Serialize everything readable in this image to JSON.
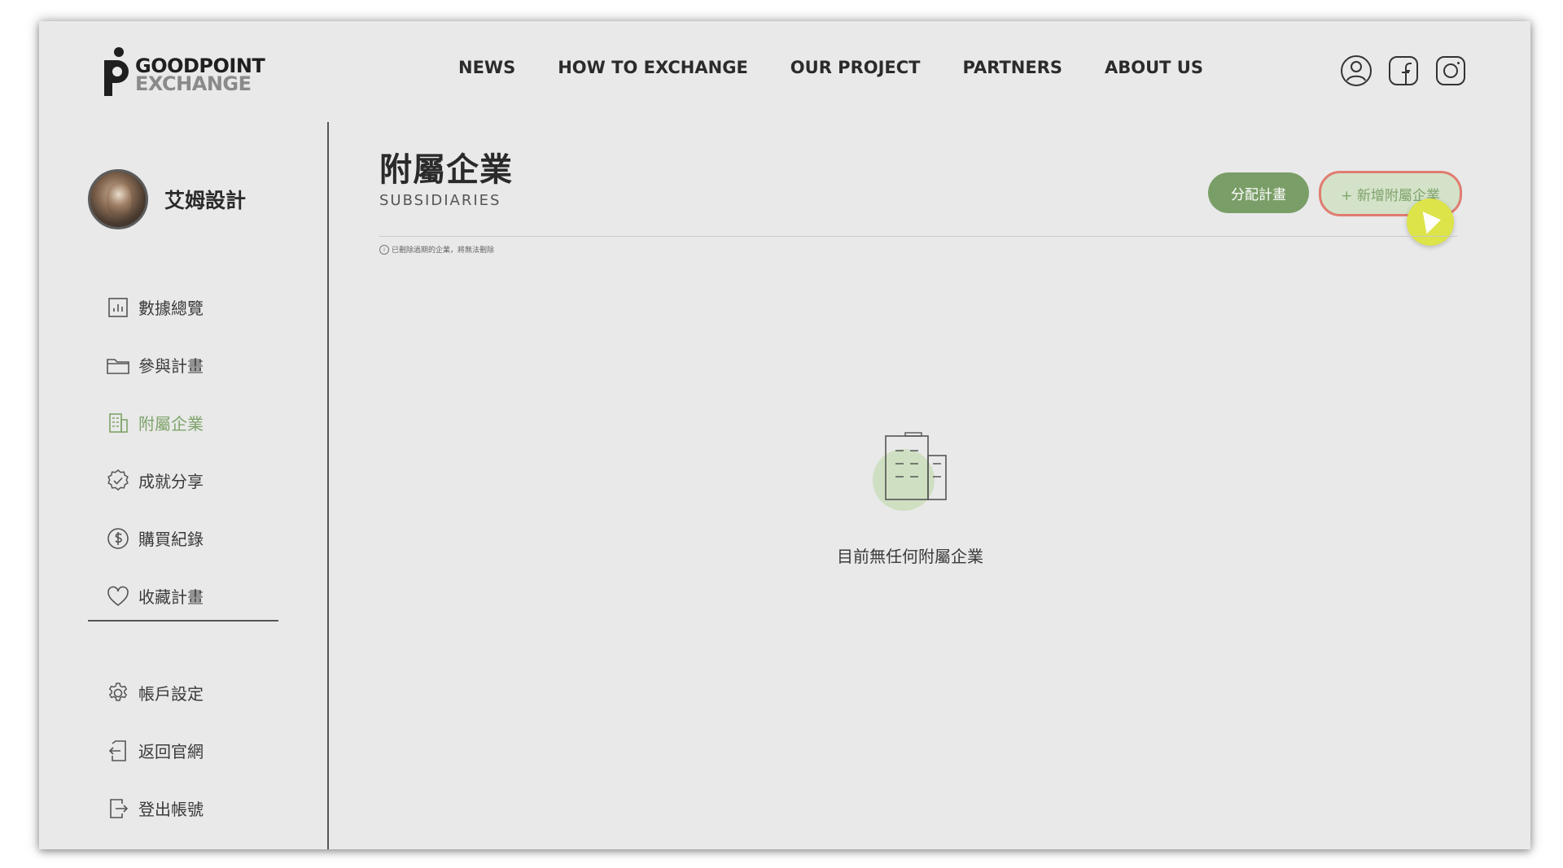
{
  "header": {
    "logo_line1": "GOODPOINT",
    "logo_line2": "EXCHANGE",
    "nav": [
      {
        "label": "NEWS"
      },
      {
        "label": "HOW TO EXCHANGE"
      },
      {
        "label": "OUR PROJECT"
      },
      {
        "label": "PARTNERS"
      },
      {
        "label": "ABOUT US"
      }
    ],
    "icons": [
      "user-icon",
      "facebook-icon",
      "instagram-icon"
    ]
  },
  "sidebar": {
    "profile_name": "艾姆設計",
    "items": [
      {
        "label": "數據總覽",
        "icon": "chart-icon",
        "active": false
      },
      {
        "label": "參與計畫",
        "icon": "folder-icon",
        "active": false
      },
      {
        "label": "附屬企業",
        "icon": "building-icon",
        "active": true
      },
      {
        "label": "成就分享",
        "icon": "badge-check-icon",
        "active": false
      },
      {
        "label": "購買紀錄",
        "icon": "dollar-icon",
        "active": false
      },
      {
        "label": "收藏計畫",
        "icon": "heart-icon",
        "active": false
      }
    ],
    "secondary_items": [
      {
        "label": "帳戶設定",
        "icon": "gear-icon"
      },
      {
        "label": "返回官網",
        "icon": "return-icon"
      },
      {
        "label": "登出帳號",
        "icon": "logout-icon"
      }
    ]
  },
  "main": {
    "title": "附屬企業",
    "subtitle": "SUBSIDIARIES",
    "assign_button": "分配計畫",
    "add_button": "+ 新增附屬企業",
    "notice": "已刪除過期的企業，將無法刪除",
    "empty_message": "目前無任何附屬企業"
  },
  "colors": {
    "accent_green": "#7a9e67",
    "active_text": "#7fa36a",
    "highlight_border": "#e07c70",
    "cursor": "#dce44a",
    "background": "#e8e9e8"
  }
}
